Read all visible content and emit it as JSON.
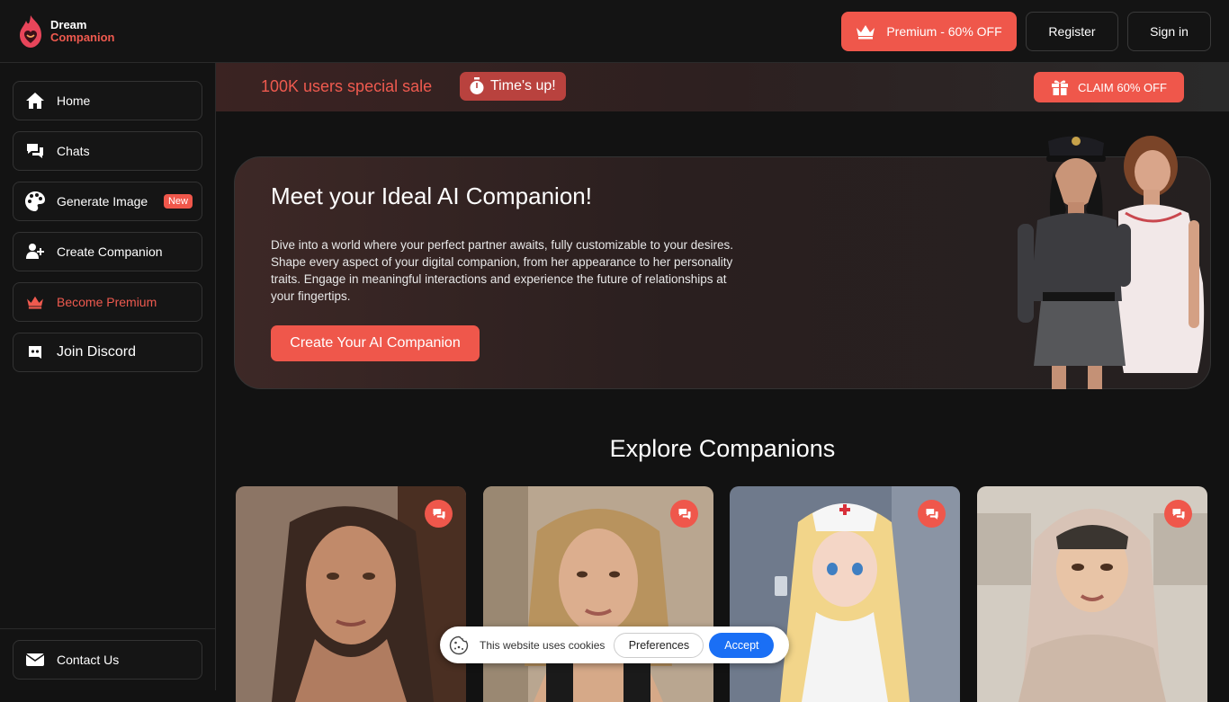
{
  "header": {
    "logo_line1": "Dream",
    "logo_line2": "Companion",
    "premium_button": "Premium - 60% OFF",
    "register_button": "Register",
    "signin_button": "Sign in"
  },
  "sidebar": {
    "items": [
      {
        "label": "Home",
        "icon": "home-icon"
      },
      {
        "label": "Chats",
        "icon": "chats-icon"
      },
      {
        "label": "Generate Image",
        "icon": "palette-icon",
        "badge": "New"
      },
      {
        "label": "Create Companion",
        "icon": "add-user-icon"
      },
      {
        "label": "Become Premium",
        "icon": "crown-icon"
      },
      {
        "label": "Join Discord",
        "icon": "discord-icon"
      }
    ],
    "contact": {
      "label": "Contact Us",
      "icon": "envelope-icon"
    }
  },
  "promo": {
    "text": "100K users special sale",
    "timer": "Time's up!",
    "claim": "CLAIM 60% OFF"
  },
  "hero": {
    "title": "Meet your Ideal AI Companion!",
    "description": "Dive into a world where your perfect partner awaits, fully customizable to your desires. Shape every aspect of your digital companion, from her appearance to her personality traits. Engage in meaningful interactions and experience the future of relationships at your fingertips.",
    "cta": "Create Your AI Companion"
  },
  "explore": {
    "title": "Explore Companions"
  },
  "cookie": {
    "text": "This website uses cookies",
    "preferences": "Preferences",
    "accept": "Accept"
  },
  "colors": {
    "accent": "#ef574b",
    "background": "#121212",
    "accept_blue": "#1a6ff5"
  }
}
